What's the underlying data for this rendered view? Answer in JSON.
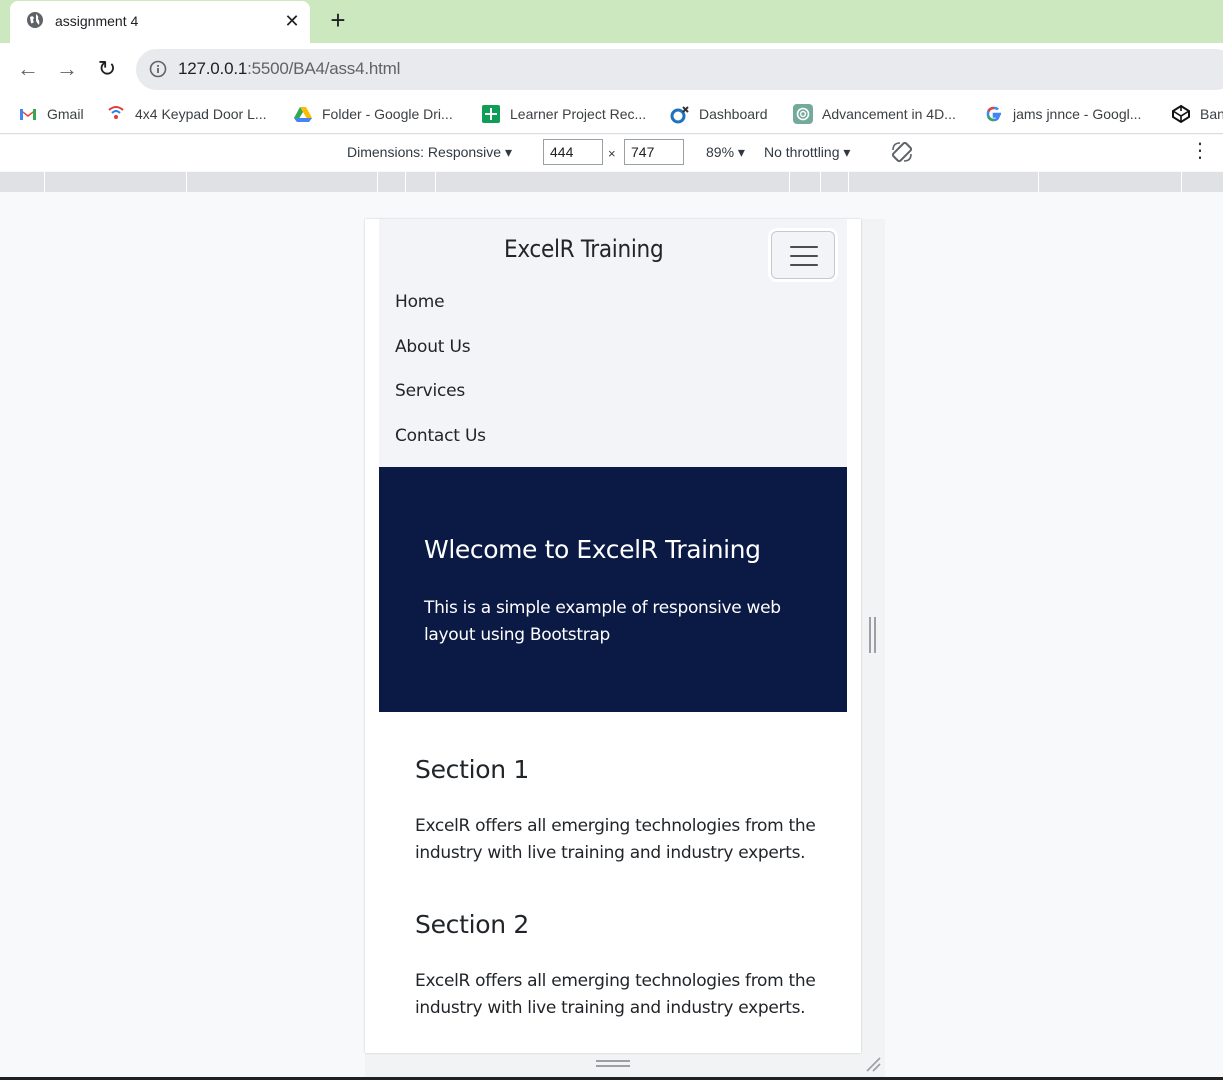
{
  "tab": {
    "title": "assignment 4",
    "close": "✕",
    "new": "+"
  },
  "toolbar": {
    "back": "←",
    "forward": "→",
    "reload": "↻",
    "url_host": "127.0.0.1",
    "url_rest": ":5500/BA4/ass4.html"
  },
  "bookmarks": [
    {
      "label": "Gmail",
      "icon": "gmail-icon"
    },
    {
      "label": "4x4 Keypad Door L...",
      "icon": "keypad-icon"
    },
    {
      "label": "Folder - Google Dri...",
      "icon": "google-drive-icon"
    },
    {
      "label": "Learner Project Rec...",
      "icon": "sheets-icon"
    },
    {
      "label": "Dashboard",
      "icon": "dashboard-icon"
    },
    {
      "label": "Advancement in 4D...",
      "icon": "chatgpt-icon"
    },
    {
      "label": "jams jnnce - Googl...",
      "icon": "google-icon"
    },
    {
      "label": "Ban",
      "icon": "codepen-icon"
    }
  ],
  "devtools": {
    "dimensions": "Dimensions: Responsive ▾",
    "width": "444",
    "times": "×",
    "height": "747",
    "zoom": "89% ▾",
    "throttling": "No throttling ▾",
    "more": "⋮"
  },
  "site": {
    "brand": "ExcelR Training",
    "nav": [
      "Home",
      "About Us",
      "Services",
      "Contact Us"
    ],
    "hero_title": "Wlecome to ExcelR Training",
    "hero_text": "This is a simple example of responsive web layout using Bootstrap",
    "sections": [
      {
        "title": "Section 1",
        "text": "ExcelR offers all emerging technologies from the industry with live training and industry experts."
      },
      {
        "title": "Section 2",
        "text": "ExcelR offers all emerging technologies from the industry with live training and industry experts."
      }
    ]
  },
  "colors": {
    "tabstrip": "#cce8bf",
    "hero_bg": "#0b1a45",
    "navbar_bg": "#f3f4f8"
  }
}
